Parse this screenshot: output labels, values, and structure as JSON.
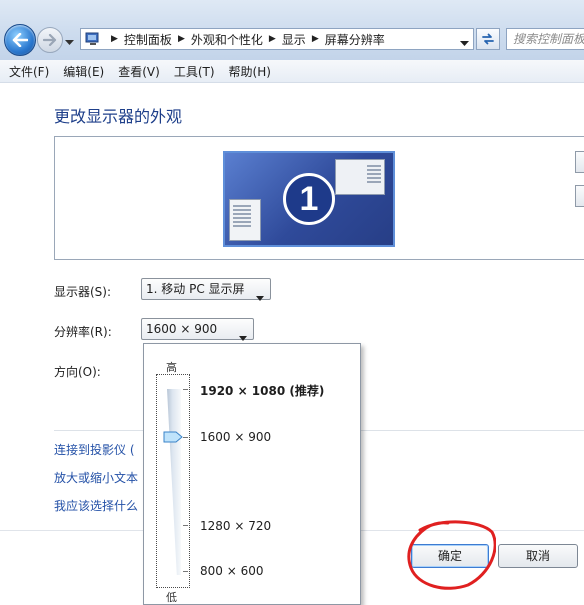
{
  "nav": {
    "breadcrumbs": [
      "控制面板",
      "外观和个性化",
      "显示",
      "屏幕分辨率"
    ],
    "search_placeholder": "搜索控制面板"
  },
  "menu": {
    "items": [
      "文件(F)",
      "编辑(E)",
      "查看(V)",
      "工具(T)",
      "帮助(H)"
    ]
  },
  "main": {
    "title": "更改显示器的外观",
    "monitor_number": "1",
    "display_label": "显示器(S):",
    "display_value": "1. 移动 PC 显示屏",
    "resolution_label": "分辨率(R):",
    "resolution_value": "1600 × 900",
    "orientation_label": "方向(O):",
    "links": [
      "连接到投影仪 (",
      "放大或缩小文本",
      "我应该选择什么"
    ]
  },
  "dropdown": {
    "high_label": "高",
    "low_label": "低",
    "options": [
      {
        "label": "1920 × 1080 (推荐)",
        "recommended": true
      },
      {
        "label": "1600 × 900",
        "selected": true
      },
      {
        "label": "1280 × 720"
      },
      {
        "label": "800 × 600"
      }
    ],
    "slider_value": "1600 × 900"
  },
  "buttons": {
    "ok": "确定",
    "cancel": "取消"
  },
  "colors": {
    "title_blue": "#1e3f8a",
    "link_blue": "#2451a7",
    "annotation_red": "#e02020"
  }
}
